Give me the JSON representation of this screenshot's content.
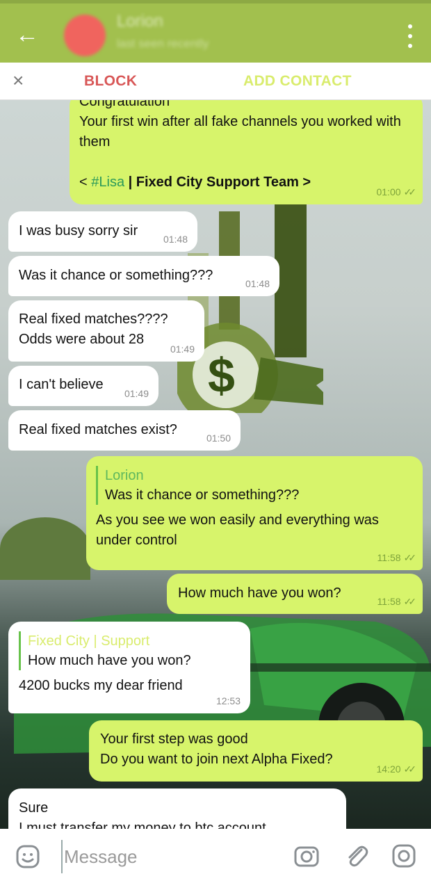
{
  "header": {
    "back_icon": "←",
    "contact_name": "Lorion",
    "contact_status": "last seen recently"
  },
  "actionbar": {
    "close_icon": "×",
    "block_label": "BLOCK",
    "add_contact_label": "ADD CONTACT"
  },
  "messages": [
    {
      "id": "m1",
      "dir": "out",
      "text_top": "Congratulation",
      "text": "Your first win after all fake channels you worked with them",
      "sig_prefix": "< ",
      "sig_link": "#Lisa",
      "sig_rest": " | Fixed City Support Team >",
      "time": "01:00"
    },
    {
      "id": "m2",
      "dir": "in",
      "text": "I was busy sorry sir",
      "time": "01:48"
    },
    {
      "id": "m3",
      "dir": "in",
      "text": "Was it chance or something???",
      "time": "01:48"
    },
    {
      "id": "m4",
      "dir": "in",
      "text": "Real fixed matches????\nOdds were about 28",
      "time": "01:49"
    },
    {
      "id": "m5",
      "dir": "in",
      "text": "I can't believe",
      "time": "01:49"
    },
    {
      "id": "m6",
      "dir": "in",
      "text": "Real fixed matches exist?",
      "time": "01:50"
    },
    {
      "id": "m7",
      "dir": "out",
      "quote_name": "Lorion",
      "quote_text": "Was it chance or something???",
      "text": "As you see we won easily and everything was under control",
      "time": "11:58"
    },
    {
      "id": "m8",
      "dir": "out",
      "text": "How much have you won?",
      "time": "11:58"
    },
    {
      "id": "m9",
      "dir": "in",
      "quote_name": "Fixed City | Support",
      "quote_text": "How much have you won?",
      "text": "4200 bucks my dear friend",
      "time": "12:53"
    },
    {
      "id": "m10",
      "dir": "out",
      "text": "Your first step was good\nDo you want to join next Alpha Fixed?",
      "time": "14:20"
    },
    {
      "id": "m11",
      "dir": "in",
      "text": "Sure\nI must transfer my money to btc account"
    }
  ],
  "composer": {
    "placeholder": "Message"
  },
  "icons": {
    "back": "arrow-left-icon",
    "menu": "more-vertical-icon",
    "close": "close-icon",
    "emoji": "sticker-icon",
    "camera": "camera-icon",
    "attach": "paperclip-icon",
    "video": "video-message-icon"
  },
  "colors": {
    "header": "#a2c04e",
    "out_bubble": "#d7f46b",
    "in_bubble": "#ffffff",
    "block": "#d85757",
    "add_contact": "#d9ec6d"
  }
}
